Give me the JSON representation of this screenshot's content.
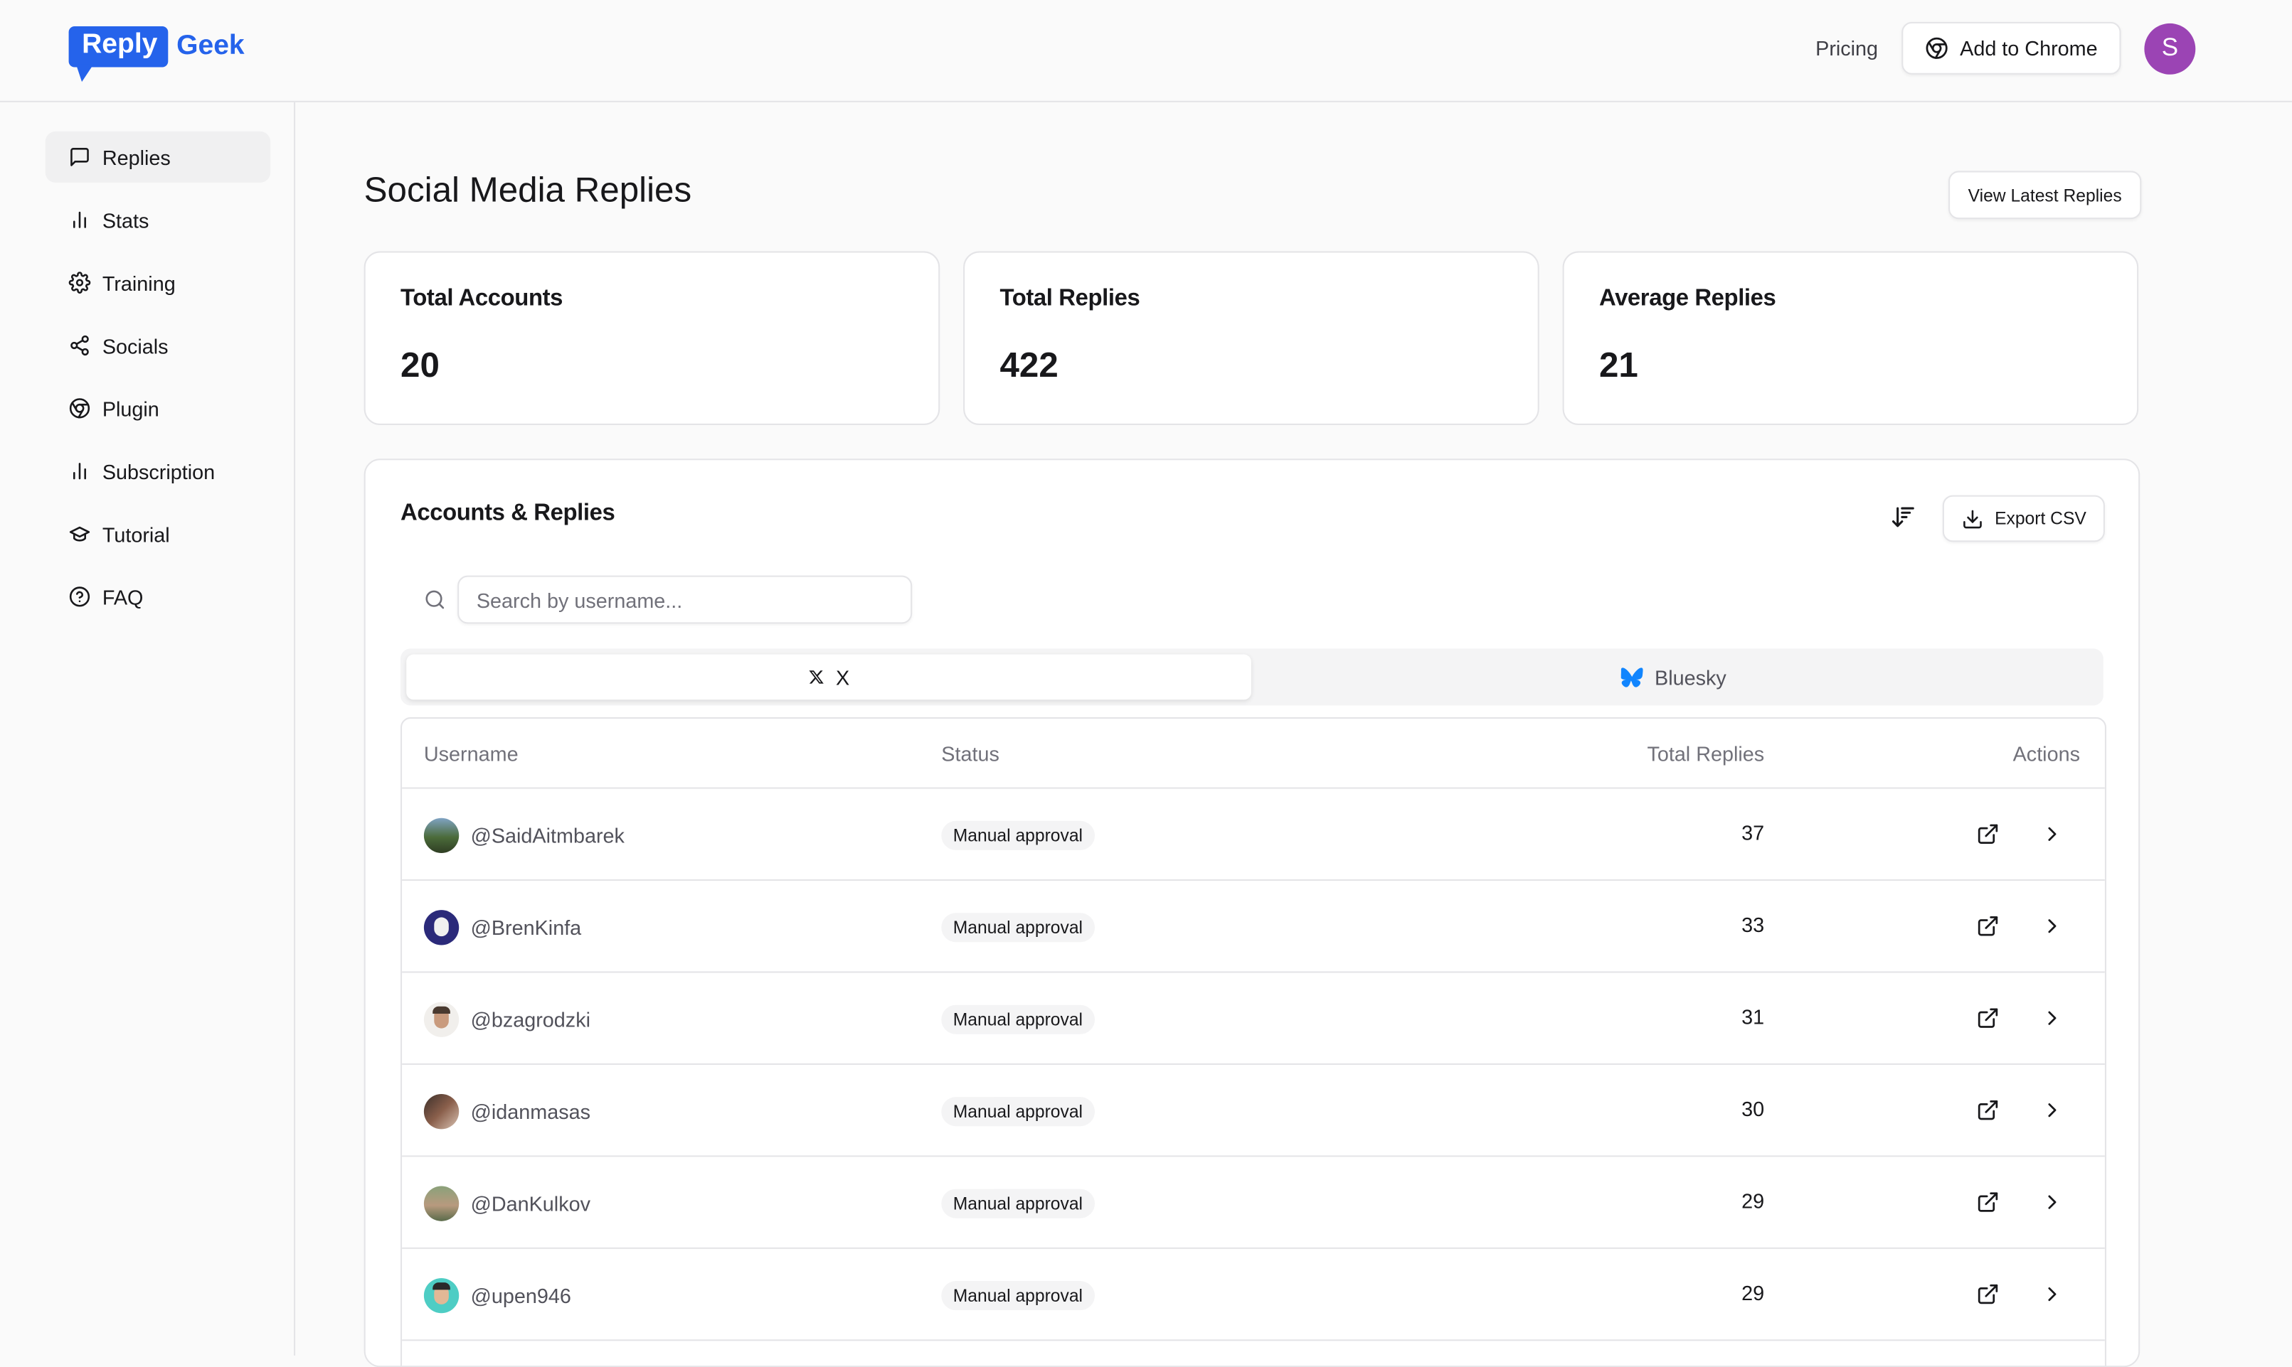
{
  "brand": {
    "logo_reply": "Reply",
    "logo_geek": "Geek",
    "primary": "#2563eb"
  },
  "header": {
    "pricing": "Pricing",
    "add_to_chrome": "Add to Chrome",
    "avatar_initial": "S",
    "avatar_color": "#9b44b4"
  },
  "sidebar": {
    "items": [
      {
        "label": "Replies",
        "icon": "message-square-icon",
        "active": true
      },
      {
        "label": "Stats",
        "icon": "bar-chart-icon"
      },
      {
        "label": "Training",
        "icon": "gear-icon"
      },
      {
        "label": "Socials",
        "icon": "share-icon"
      },
      {
        "label": "Plugin",
        "icon": "chrome-icon"
      },
      {
        "label": "Subscription",
        "icon": "bar-chart-icon"
      },
      {
        "label": "Tutorial",
        "icon": "graduation-cap-icon"
      },
      {
        "label": "FAQ",
        "icon": "help-circle-icon"
      }
    ]
  },
  "main": {
    "title": "Social Media Replies",
    "view_latest": "View Latest Replies",
    "stats": [
      {
        "label": "Total Accounts",
        "value": "20"
      },
      {
        "label": "Total Replies",
        "value": "422"
      },
      {
        "label": "Average Replies",
        "value": "21"
      }
    ],
    "accounts": {
      "title": "Accounts & Replies",
      "export": "Export CSV",
      "search_placeholder": "Search by username...",
      "tabs": [
        {
          "label": "X",
          "icon": "x-logo-icon",
          "active": true
        },
        {
          "label": "Bluesky",
          "icon": "bluesky-butterfly-icon",
          "active": false
        }
      ],
      "columns": {
        "username": "Username",
        "status": "Status",
        "total": "Total Replies",
        "actions": "Actions"
      },
      "rows": [
        {
          "username": "@SaidAitmbarek",
          "status": "Manual approval",
          "total": "37"
        },
        {
          "username": "@BrenKinfa",
          "status": "Manual approval",
          "total": "33"
        },
        {
          "username": "@bzagrodzki",
          "status": "Manual approval",
          "total": "31"
        },
        {
          "username": "@idanmasas",
          "status": "Manual approval",
          "total": "30"
        },
        {
          "username": "@DanKulkov",
          "status": "Manual approval",
          "total": "29"
        },
        {
          "username": "@upen946",
          "status": "Manual approval",
          "total": "29"
        }
      ]
    }
  }
}
